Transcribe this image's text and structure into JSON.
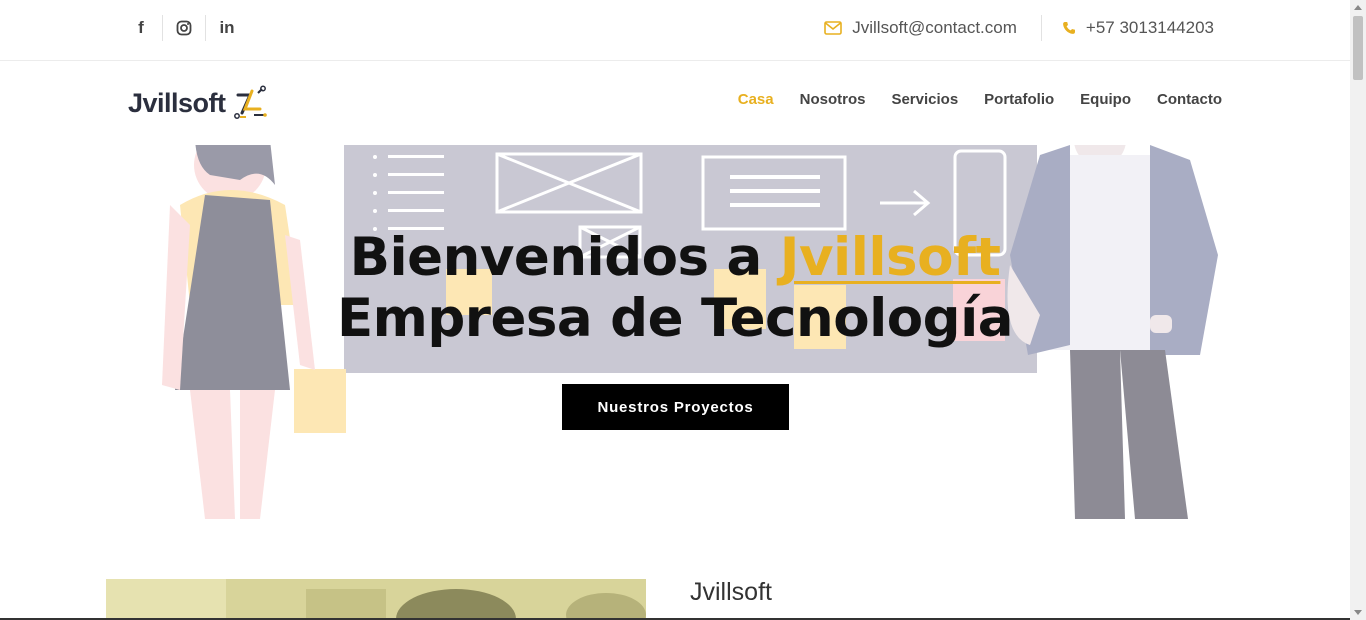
{
  "social": [
    {
      "name": "facebook-icon",
      "glyph": "f"
    },
    {
      "name": "instagram-icon",
      "glyph": ""
    },
    {
      "name": "linkedin-icon",
      "glyph": "in"
    }
  ],
  "contact": {
    "email": "Jvillsoft@contact.com",
    "phone": "+57 3013144203"
  },
  "logo": {
    "text": "Jvillsoft"
  },
  "nav": {
    "items": [
      {
        "label": "Casa",
        "active": true
      },
      {
        "label": "Nosotros"
      },
      {
        "label": "Servicios"
      },
      {
        "label": "Portafolio"
      },
      {
        "label": "Equipo"
      },
      {
        "label": "Contacto"
      }
    ]
  },
  "hero": {
    "title_prefix": "Bienvenidos a ",
    "title_brand": "Jvillsoft",
    "title_line2": "Empresa de Tecnología",
    "button": "Nuestros Proyectos"
  },
  "about": {
    "title": "Jvillsoft"
  },
  "colors": {
    "accent": "#e8b020",
    "dark": "#2b2f3e"
  }
}
